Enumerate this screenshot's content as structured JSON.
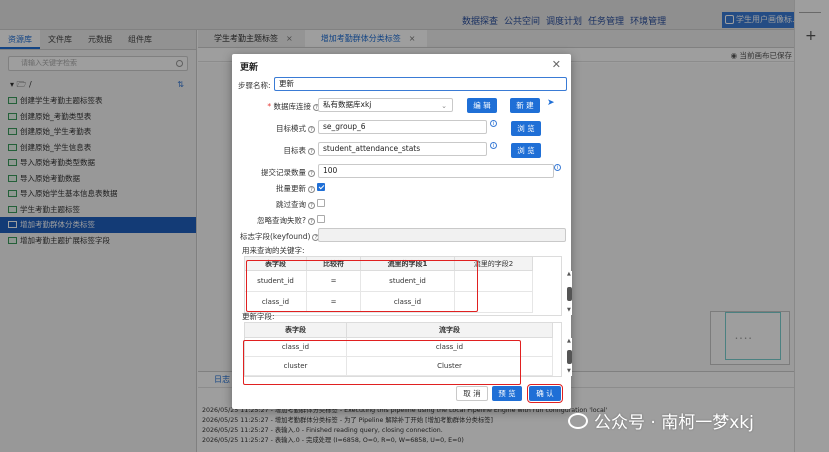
{
  "topnav": [
    "数据探查",
    "公共空间",
    "调度计划",
    "任务管理",
    "环境管理"
  ],
  "user_button": "学生用户画像标...",
  "left": {
    "tabs": [
      "资源库",
      "文件库",
      "元数据",
      "组件库"
    ],
    "search_placeholder": "请输入关键字检索",
    "root": "/",
    "items": [
      "创建学生考勤主题标签表",
      "创建原始_考勤类型表",
      "创建原始_学生考勤表",
      "创建原始_学生信息表",
      "导入原始考勤类型数据",
      "导入原始考勤数据",
      "导入原始学生基本信息表数据",
      "学生考勤主题标签",
      "增加考勤群体分类标签",
      "增加考勤主题扩展标签字段"
    ],
    "selected_index": 8
  },
  "editor": {
    "tabs": [
      {
        "label": "学生考勤主题标签"
      },
      {
        "label": "增加考勤群体分类标签"
      }
    ],
    "saved_status": "当前画布已保存",
    "log_title": "日志",
    "log_lines": [
      "2026/05/25 11:25:27 - 增加考勤群体分类标签 - Executing this pipeline using the Local Pipeline Engine with run configuration 'local'",
      "2026/05/25 11:25:27 - 增加考勤群体分类标签 - 为了 Pipeline 解除补丁开始 [增加考勤群体分类标签]",
      "2026/05/25 11:25:27 - 表输入.0 - Finished reading query, closing connection.",
      "2026/05/25 11:25:27 - 表输入.0 - 完成处理 (I=6858, O=0, R=0, W=6858, U=0, E=0)"
    ]
  },
  "dialog": {
    "title": "更新",
    "step_name_label": "步骤名称:",
    "step_name": "更新",
    "db_conn_label": "数据库连接",
    "db_conn": "私有数据库xkj",
    "edit_btn": "编 辑",
    "new_btn": "新 建",
    "schema_label": "目标模式",
    "schema": "se_group_6",
    "browse_btn": "浏 览",
    "table_label": "目标表",
    "table": "student_attendance_stats",
    "commit_label": "提交记录数量",
    "commit": "100",
    "batch_label": "批量更新",
    "skip_label": "跳过查询",
    "ignore_label": "忽略查询失败?",
    "flag_label": "标志字段(keyfound)",
    "keys_section": "用来查询的关键字:",
    "keys_headers": [
      "表字段",
      "比较符",
      "流里的字段1",
      "流里的字段2"
    ],
    "keys_rows": [
      [
        "student_id",
        "=",
        "student_id",
        ""
      ],
      [
        "class_id",
        "=",
        "class_id",
        ""
      ]
    ],
    "update_section": "更新字段:",
    "update_headers": [
      "表字段",
      "流字段"
    ],
    "update_rows": [
      [
        "class_id",
        "class_id"
      ],
      [
        "cluster",
        "Cluster"
      ]
    ],
    "cancel_btn": "取 消",
    "preview_btn": "预 览",
    "ok_btn": "确 认"
  },
  "watermark": "公众号 · 南柯一梦xkj"
}
